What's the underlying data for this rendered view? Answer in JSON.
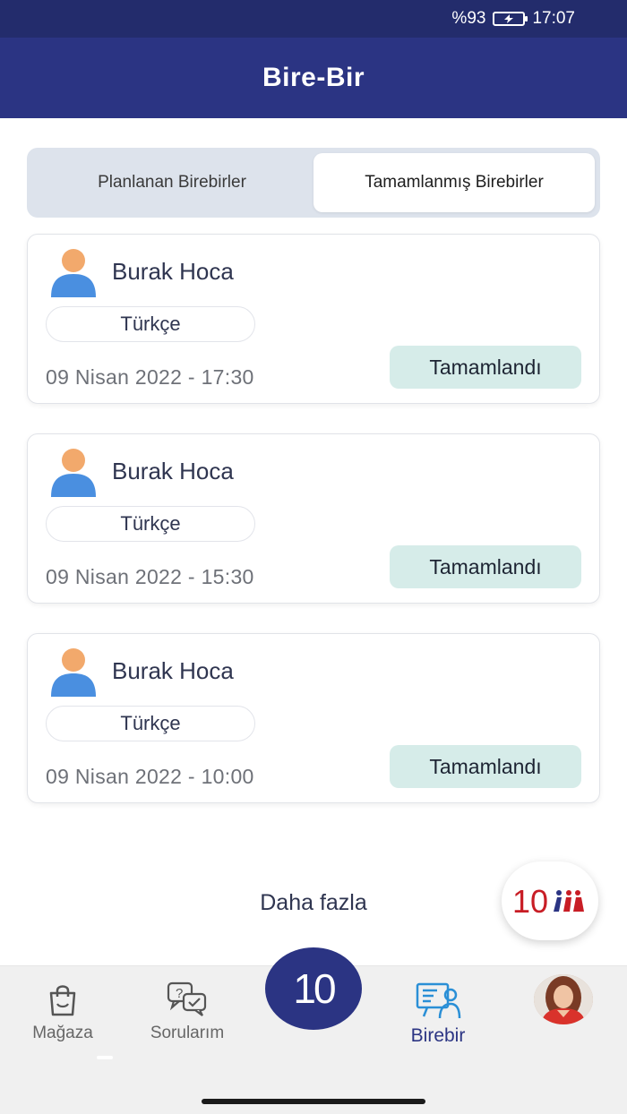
{
  "status_bar": {
    "battery": "%93",
    "time": "17:07"
  },
  "header": {
    "title": "Bire-Bir"
  },
  "tabs": [
    {
      "label": "Planlanan Birebirler",
      "active": false
    },
    {
      "label": "Tamamlanmış Birebirler",
      "active": true
    }
  ],
  "sessions": [
    {
      "teacher": "Burak Hoca",
      "subject": "Türkçe",
      "datetime": "09 Nisan 2022 - 17:30",
      "status": "Tamamlandı"
    },
    {
      "teacher": "Burak Hoca",
      "subject": "Türkçe",
      "datetime": "09 Nisan 2022 - 15:30",
      "status": "Tamamlandı"
    },
    {
      "teacher": "Burak Hoca",
      "subject": "Türkçe",
      "datetime": "09 Nisan 2022 - 10:00",
      "status": "Tamamlandı"
    }
  ],
  "more_label": "Daha fazla",
  "fab": {
    "text": "10"
  },
  "bottom_nav": {
    "store": "Mağaza",
    "questions": "Sorularım",
    "center": "10",
    "birebir": "Birebir"
  },
  "colors": {
    "primary": "#2b3483",
    "status_badge": "#d6ece9",
    "avatar_orange": "#f2a96c",
    "avatar_blue": "#4a8fe0"
  }
}
